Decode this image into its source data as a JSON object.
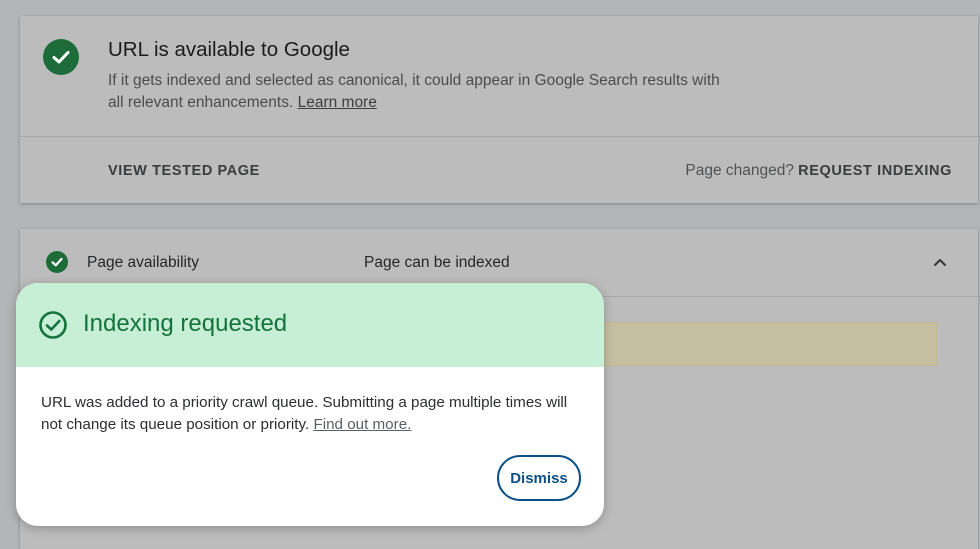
{
  "status_card": {
    "title": "URL is available to Google",
    "description": "If it gets indexed and selected as canonical, it could appear in Google Search results with all relevant enhancements.",
    "learn_more": "Learn more",
    "view_tested_page": "VIEW TESTED PAGE",
    "page_changed": "Page changed?",
    "request_indexing": "REQUEST INDEXING",
    "icon": "check-circle-icon"
  },
  "availability": {
    "label": "Page availability",
    "value": "Page can be indexed",
    "icon": "check-circle-icon",
    "toggle_icon": "chevron-up-icon"
  },
  "dialog": {
    "title": "Indexing requested",
    "body": "URL was added to a priority crawl queue. Submitting a page multiple times will not change its queue position or priority.",
    "find_out_more": "Find out more.",
    "dismiss": "Dismiss",
    "icon": "check-circle-outline-icon"
  },
  "colors": {
    "success_green": "#1e6b3a",
    "dialog_header": "#c6efd6",
    "dialog_title": "#15723d",
    "dismiss_accent": "#0a4f85"
  }
}
